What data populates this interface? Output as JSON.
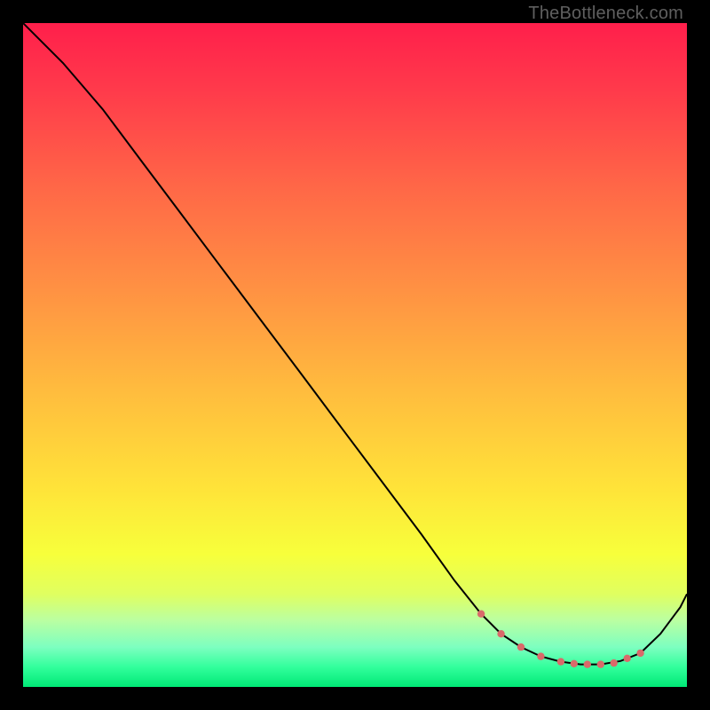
{
  "watermark": "TheBottleneck.com",
  "gradient_stops": [
    {
      "offset": 0.0,
      "color": "#ff1f4b"
    },
    {
      "offset": 0.1,
      "color": "#ff3a4b"
    },
    {
      "offset": 0.25,
      "color": "#ff6847"
    },
    {
      "offset": 0.4,
      "color": "#ff9143"
    },
    {
      "offset": 0.55,
      "color": "#ffbb3e"
    },
    {
      "offset": 0.7,
      "color": "#ffe339"
    },
    {
      "offset": 0.8,
      "color": "#f7ff3b"
    },
    {
      "offset": 0.86,
      "color": "#e0ff60"
    },
    {
      "offset": 0.9,
      "color": "#baffa2"
    },
    {
      "offset": 0.94,
      "color": "#7dffc0"
    },
    {
      "offset": 0.97,
      "color": "#32ff9c"
    },
    {
      "offset": 1.0,
      "color": "#00e876"
    }
  ],
  "chart_data": {
    "type": "line",
    "title": "",
    "xlabel": "",
    "ylabel": "",
    "xlim": [
      0,
      100
    ],
    "ylim": [
      0,
      100
    ],
    "series": [
      {
        "name": "curve",
        "stroke": "#000000",
        "stroke_width": 2,
        "x": [
          0,
          6,
          12,
          18,
          24,
          30,
          36,
          42,
          48,
          54,
          60,
          65,
          69,
          72,
          75,
          78,
          81,
          84,
          87,
          90,
          93,
          96,
          99,
          100
        ],
        "y": [
          100,
          94,
          87,
          79,
          71,
          63,
          55,
          47,
          39,
          31,
          23,
          16,
          11,
          8,
          6,
          4.6,
          3.8,
          3.4,
          3.4,
          3.9,
          5.1,
          8,
          12,
          14
        ]
      }
    ],
    "marker_zone": {
      "name": "bottom-dots",
      "color": "#d96a6a",
      "radius": 4.2,
      "x": [
        69,
        72,
        75,
        78,
        81,
        83,
        85,
        87,
        89,
        91,
        93
      ],
      "y": [
        11,
        8,
        6,
        4.6,
        3.8,
        3.5,
        3.4,
        3.4,
        3.6,
        4.3,
        5.1
      ]
    }
  }
}
